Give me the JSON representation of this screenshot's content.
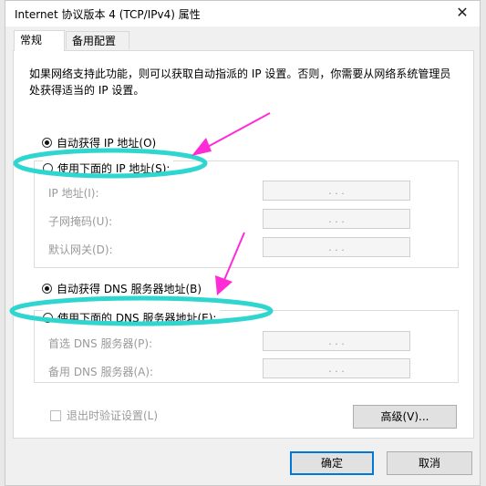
{
  "window": {
    "title": "Internet 协议版本 4 (TCP/IPv4) 属性",
    "close_glyph": "✕"
  },
  "tabs": [
    {
      "label": "常规",
      "active": true
    },
    {
      "label": "备用配置",
      "active": false
    }
  ],
  "description": "如果网络支持此功能，则可以获取自动指派的 IP 设置。否则，你需要从网络系统管理员处获得适当的 IP 设置。",
  "ip_section": {
    "auto_label": "自动获得 IP 地址(O)",
    "manual_label": "使用下面的 IP 地址(S):",
    "selected": "auto",
    "fields": [
      {
        "label": "IP 地址(I):",
        "value": ".  .  ."
      },
      {
        "label": "子网掩码(U):",
        "value": ".  .  ."
      },
      {
        "label": "默认网关(D):",
        "value": ".  .  ."
      }
    ]
  },
  "dns_section": {
    "auto_label": "自动获得 DNS 服务器地址(B)",
    "manual_label": "使用下面的 DNS 服务器地址(E):",
    "selected": "auto",
    "fields": [
      {
        "label": "首选 DNS 服务器(P):",
        "value": ".  .  ."
      },
      {
        "label": "备用 DNS 服务器(A):",
        "value": ".  .  ."
      }
    ]
  },
  "validate_checkbox": {
    "label": "退出时验证设置(L)",
    "checked": false
  },
  "buttons": {
    "advanced": "高级(V)...",
    "ok": "确定",
    "cancel": "取消"
  },
  "annotations": {
    "arrow_color": "#ff2bd6",
    "ellipse_color": "#2fd6d0"
  }
}
